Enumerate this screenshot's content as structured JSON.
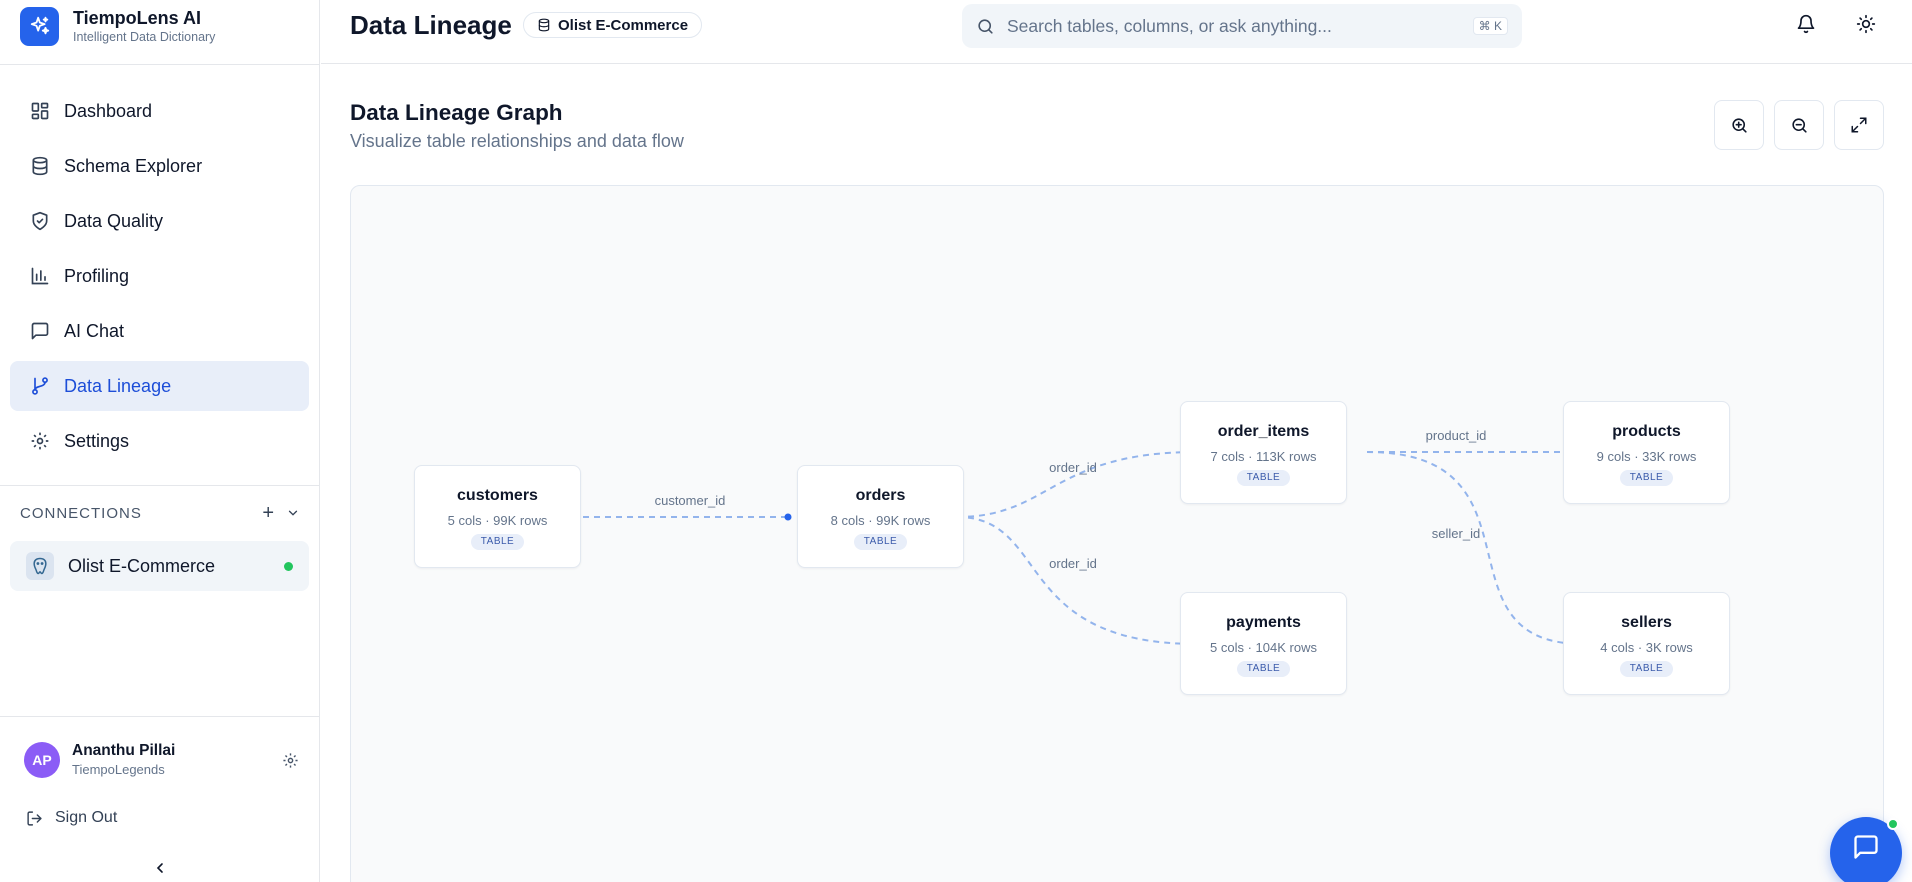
{
  "brand": {
    "name": "TiempoLens AI",
    "subtitle": "Intelligent Data Dictionary",
    "icon": "sparkles-icon",
    "color": "#2563eb"
  },
  "nav": {
    "items": [
      {
        "label": "Dashboard",
        "icon": "dashboard-icon",
        "active": false
      },
      {
        "label": "Schema Explorer",
        "icon": "database-icon",
        "active": false
      },
      {
        "label": "Data Quality",
        "icon": "shield-check-icon",
        "active": false
      },
      {
        "label": "Profiling",
        "icon": "bar-chart-icon",
        "active": false
      },
      {
        "label": "AI Chat",
        "icon": "message-square-icon",
        "active": false
      },
      {
        "label": "Data Lineage",
        "icon": "git-branch-icon",
        "active": true
      },
      {
        "label": "Settings",
        "icon": "gear-icon",
        "active": false
      }
    ]
  },
  "connections": {
    "title": "CONNECTIONS",
    "add_symbol": "+",
    "items": [
      {
        "label": "Olist E-Commerce",
        "icon": "postgres-icon",
        "status": "connected",
        "status_color": "#22c55e"
      }
    ]
  },
  "user": {
    "initials": "AP",
    "name": "Ananthu Pillai",
    "org": "TiempoLegends",
    "avatar_color": "#8b5cf6"
  },
  "signout": {
    "label": "Sign Out"
  },
  "header": {
    "title": "Data Lineage",
    "database": "Olist E-Commerce",
    "search": {
      "placeholder": "Search tables, columns, or ask anything...",
      "shortcut": "⌘ K"
    }
  },
  "main": {
    "title": "Data Lineage Graph",
    "subtitle": "Visualize table relationships and data flow",
    "toolbar": [
      "zoom-in-icon",
      "zoom-out-icon",
      "maximize-icon"
    ]
  },
  "lineage": {
    "nodes": [
      {
        "id": "customers",
        "name": "customers",
        "meta": "5 cols · 99K rows",
        "badge": "TABLE"
      },
      {
        "id": "orders",
        "name": "orders",
        "meta": "8 cols · 99K rows",
        "badge": "TABLE"
      },
      {
        "id": "order_items",
        "name": "order_items",
        "meta": "7 cols · 113K rows",
        "badge": "TABLE"
      },
      {
        "id": "products",
        "name": "products",
        "meta": "9 cols · 33K rows",
        "badge": "TABLE"
      },
      {
        "id": "payments",
        "name": "payments",
        "meta": "5 cols · 104K rows",
        "badge": "TABLE"
      },
      {
        "id": "sellers",
        "name": "sellers",
        "meta": "4 cols · 3K rows",
        "badge": "TABLE"
      }
    ],
    "edges": [
      {
        "from": "customers",
        "to": "orders",
        "label": "customer_id"
      },
      {
        "from": "orders",
        "to": "order_items",
        "label": "order_id"
      },
      {
        "from": "orders",
        "to": "payments",
        "label": "order_id"
      },
      {
        "from": "order_items",
        "to": "products",
        "label": "product_id"
      },
      {
        "from": "order_items",
        "to": "sellers",
        "label": "seller_id"
      }
    ],
    "edge_color": "#93b4ec",
    "handle_color": "#2563eb"
  }
}
